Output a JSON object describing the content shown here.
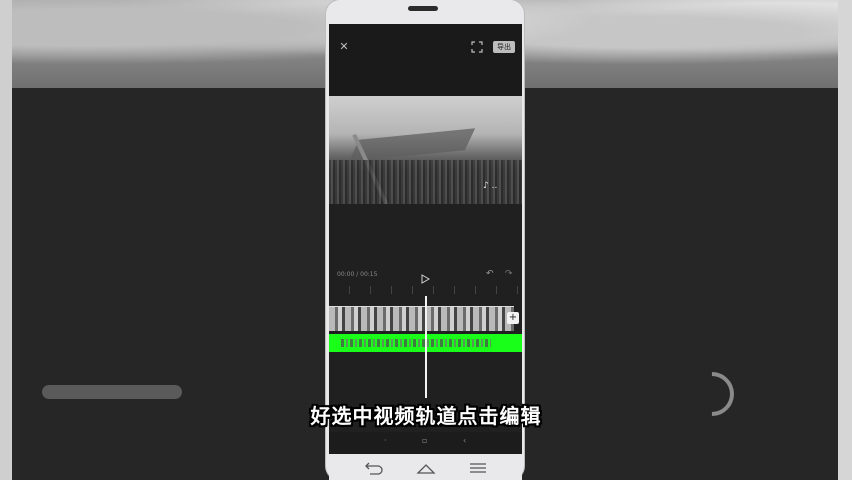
{
  "editor": {
    "export_label": "导出",
    "preview_watermark": "♪ ..",
    "time_readout": "00:00 / 00:15"
  },
  "subtitle": "好选中视频轨道点击编辑",
  "colors": {
    "audio_track": "#1aff1a",
    "playhead": "#f2f2f2",
    "subtitle_text": "#ffffff"
  },
  "icons": {
    "close": "close-icon",
    "fullscreen": "fullscreen-icon",
    "play": "play-icon",
    "undo": "undo-icon",
    "redo": "redo-icon",
    "add": "plus-icon",
    "nav_back": "back-icon",
    "nav_home": "home-icon",
    "nav_menu": "menu-icon"
  }
}
